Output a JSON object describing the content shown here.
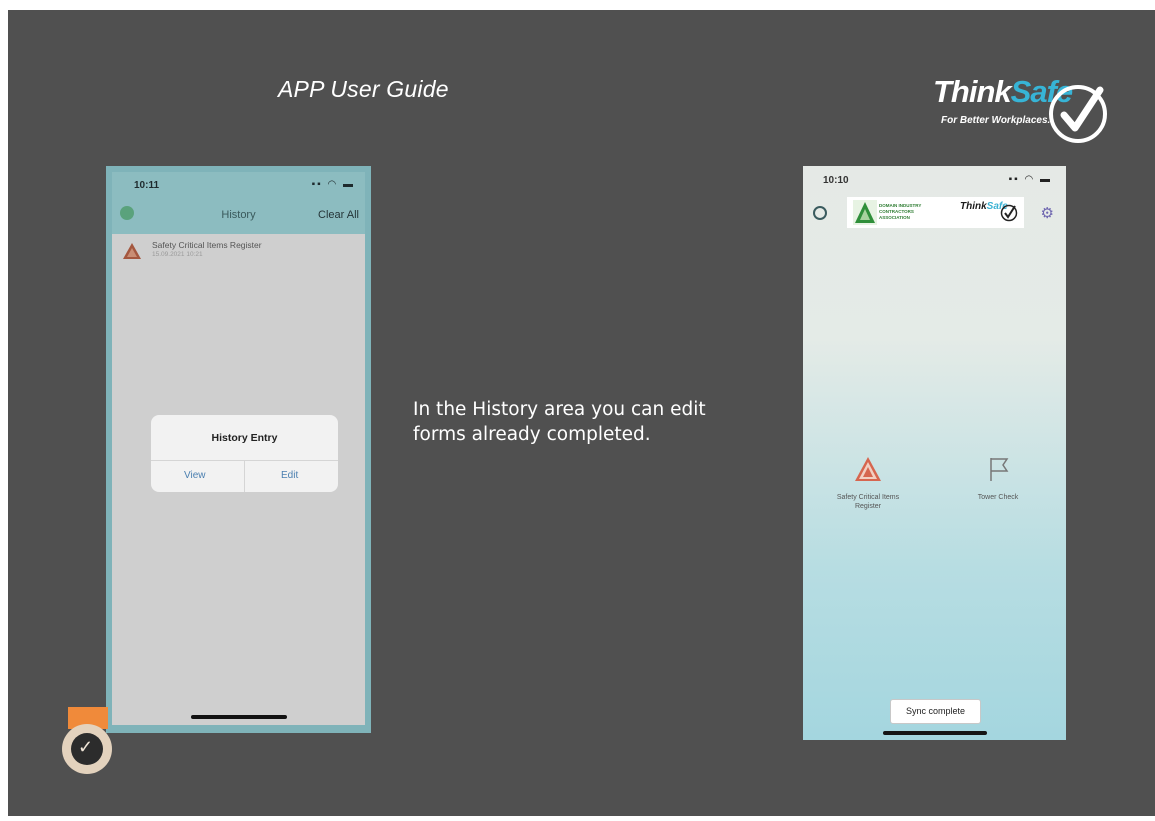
{
  "slide": {
    "title": "APP User Guide",
    "description": "In the History area you can edit forms already completed."
  },
  "logo": {
    "brand_main": "Think",
    "brand_accent": "Safe",
    "tagline": "For Better Workplaces.",
    "icon": "checkmark-circle-icon"
  },
  "left_phone": {
    "status_time": "10:11",
    "status_icons": "signal wifi battery",
    "nav_title": "History",
    "clear_label": "Clear All",
    "history_items": [
      {
        "title": "Safety Critical Items Register",
        "date": "15.09.2021 10:21",
        "icon": "warning-triangle-icon"
      }
    ],
    "modal": {
      "title": "History Entry",
      "view_label": "View",
      "edit_label": "Edit"
    }
  },
  "right_phone": {
    "status_time": "10:10",
    "status_icons": "signal wifi battery",
    "banner": {
      "org_line1": "DOMAIN INDUSTRY",
      "org_line2": "CONTRACTORS",
      "org_line3": "ASSOCIATION",
      "mini_brand_main": "Think",
      "mini_brand_accent": "Safe"
    },
    "tiles": [
      {
        "label": "Safety Critical Items Register",
        "icon": "warning-triangle-icon"
      },
      {
        "label": "Tower Check",
        "icon": "flag-icon"
      }
    ],
    "sync_label": "Sync complete"
  },
  "colors": {
    "slide_bg": "#505050",
    "accent": "#37b4d6",
    "left_frame": "#7fb3b9",
    "badge_orange": "#f08a3a"
  }
}
